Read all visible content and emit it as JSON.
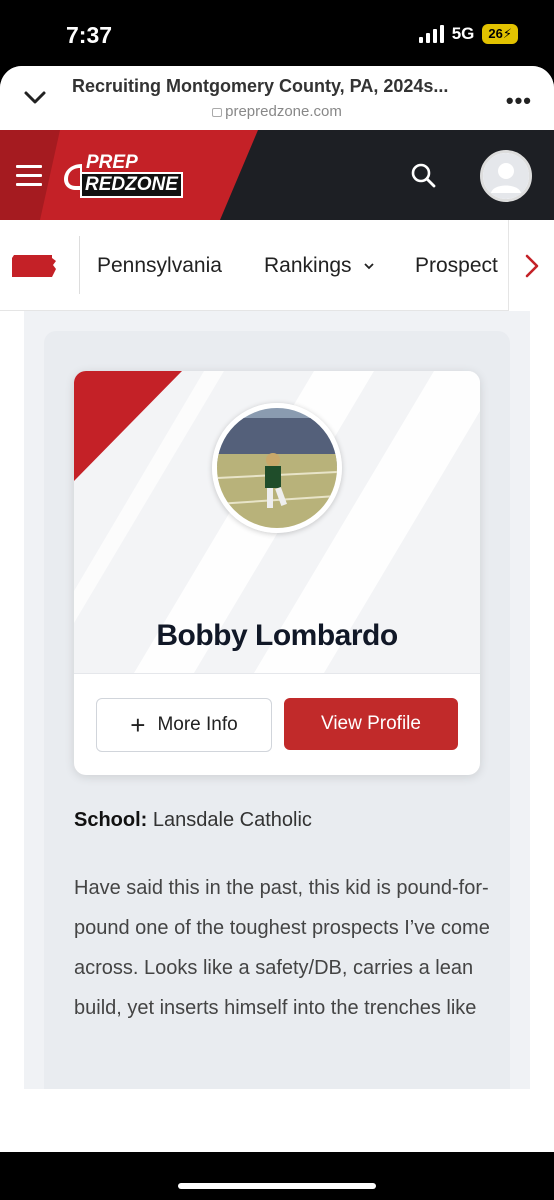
{
  "status_bar": {
    "time": "7:37",
    "network": "5G",
    "battery": "26"
  },
  "browser": {
    "page_title": "Recruiting Montgomery County, PA, 2024s...",
    "domain": "prepredzone.com",
    "more_label": "•••"
  },
  "site_header": {
    "logo_top": "PREP",
    "logo_bottom": "REDZONE",
    "brand_red": "#c42127",
    "header_bg": "#1d1f24"
  },
  "nav": {
    "items": [
      "Pennsylvania",
      "Rankings",
      "Prospect"
    ],
    "rankings_caret": "⌄",
    "next_arrow": "›"
  },
  "profile": {
    "name": "Bobby Lombardo",
    "more_info_icon": "+",
    "more_info_label": "More Info",
    "view_profile_label": "View Profile"
  },
  "article": {
    "school_label": "School:",
    "school_value": "Lansdale Catholic",
    "paragraph": "Have said this in the past, this kid is pound-for-pound one of the toughest prospects I’ve come across. Looks like a safety/DB, carries a lean build, yet inserts himself into the trenches like"
  },
  "toolbar": {
    "icons": [
      "back-icon",
      "forward-icon",
      "reload-icon",
      "share-icon"
    ]
  }
}
